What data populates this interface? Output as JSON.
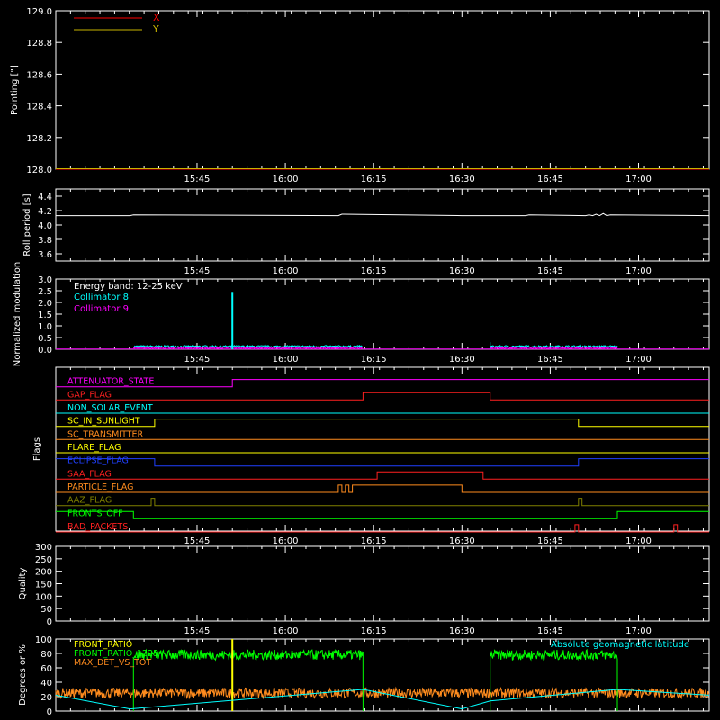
{
  "colors": {
    "background": "#000000",
    "axis": "#ffffff",
    "x_series": "#ff0000",
    "y_series": "#c8b400",
    "cyan": "#00ffff",
    "magenta": "#ff00ff",
    "green": "#00ff00",
    "orange": "#ff8c1e",
    "yellow": "#ffff00"
  },
  "time_axis": {
    "range_min": [
      15.35,
      17.2
    ],
    "tick_labels": [
      "15:45",
      "16:00",
      "16:15",
      "16:30",
      "16:45",
      "17:00"
    ],
    "tick_values_min": [
      15.75,
      16.0,
      16.25,
      16.5,
      16.75,
      17.0
    ]
  },
  "chart_data": [
    {
      "type": "line",
      "panel": "pointing",
      "ylabel": "Pointing [\"]",
      "ylim": [
        128.0,
        129.0
      ],
      "yticks": [
        "128.0",
        "128.2",
        "128.4",
        "128.6",
        "128.8",
        "129.0"
      ],
      "series": [
        {
          "name": "X",
          "x": [
            15.35,
            17.2
          ],
          "y": [
            128.0,
            128.0
          ]
        },
        {
          "name": "Y",
          "x": [
            15.35,
            17.2
          ],
          "y": [
            128.0,
            128.0
          ]
        }
      ],
      "legend_placement": "top-left"
    },
    {
      "type": "line",
      "panel": "roll",
      "ylabel": "Roll period [s]",
      "ylim": [
        3.5,
        4.5
      ],
      "yticks": [
        "3.6",
        "3.8",
        "4.0",
        "4.2",
        "4.4"
      ],
      "series": [
        {
          "x": [
            15.35,
            15.56,
            15.57,
            16.15,
            16.16,
            16.5,
            16.68,
            16.69,
            16.85,
            16.86,
            16.87,
            16.88,
            16.89,
            16.9,
            16.91,
            16.92,
            17.2
          ],
          "y": [
            4.13,
            4.13,
            4.14,
            4.13,
            4.15,
            4.13,
            4.13,
            4.14,
            4.13,
            4.14,
            4.13,
            4.15,
            4.13,
            4.16,
            4.13,
            4.14,
            4.13
          ]
        }
      ]
    },
    {
      "type": "line",
      "panel": "modulation",
      "ylabel": "Normalized modulation",
      "ylim": [
        0,
        3.0
      ],
      "yticks": [
        "0.0",
        "0.5",
        "1.0",
        "1.5",
        "2.0",
        "2.5",
        "3.0"
      ],
      "annotation": "Energy band: 12-25 keV",
      "active_intervals": [
        [
          15.57,
          16.22
        ],
        [
          16.58,
          16.94
        ]
      ],
      "series": [
        {
          "name": "Collimator 8",
          "base": 0.08,
          "spike_x": 15.85,
          "spike_y": 2.45
        },
        {
          "name": "Collimator 9",
          "base": 0.03
        }
      ]
    },
    {
      "type": "line",
      "panel": "flags",
      "ylabel": "Flags",
      "flags": [
        {
          "name": "ATTENUATOR_STATE",
          "color": "#ff00ff",
          "steps": [
            [
              15.35,
              0
            ],
            [
              15.85,
              1
            ],
            [
              17.2,
              1
            ]
          ]
        },
        {
          "name": "GAP_FLAG",
          "color": "#ff2020",
          "steps": [
            [
              15.35,
              0
            ],
            [
              16.22,
              1
            ],
            [
              16.58,
              0
            ],
            [
              17.2,
              0
            ]
          ]
        },
        {
          "name": "NON_SOLAR_EVENT",
          "color": "#00ffff",
          "steps": [
            [
              15.35,
              0
            ],
            [
              17.2,
              0
            ]
          ]
        },
        {
          "name": "SC_IN_SUNLIGHT",
          "color": "#ffff00",
          "steps": [
            [
              15.35,
              0
            ],
            [
              15.63,
              1
            ],
            [
              16.83,
              0
            ],
            [
              17.2,
              0
            ]
          ]
        },
        {
          "name": "SC_TRANSMITTER",
          "color": "#ff8c1e",
          "steps": [
            [
              15.35,
              0
            ],
            [
              17.2,
              0
            ]
          ]
        },
        {
          "name": "FLARE_FLAG",
          "color": "#ffff00",
          "steps": [
            [
              15.35,
              0
            ],
            [
              17.2,
              0
            ]
          ]
        },
        {
          "name": "ECLIPSE_FLAG",
          "color": "#2040ff",
          "steps": [
            [
              15.35,
              1
            ],
            [
              15.63,
              0
            ],
            [
              16.83,
              1
            ],
            [
              17.2,
              1
            ]
          ]
        },
        {
          "name": "SAA_FLAG",
          "color": "#ff2020",
          "steps": [
            [
              15.35,
              0
            ],
            [
              16.26,
              1
            ],
            [
              16.56,
              0
            ],
            [
              17.2,
              0
            ]
          ]
        },
        {
          "name": "PARTICLE_FLAG",
          "color": "#ff8c1e",
          "steps": [
            [
              15.35,
              0
            ],
            [
              16.15,
              1
            ],
            [
              16.16,
              0
            ],
            [
              16.17,
              1
            ],
            [
              16.18,
              0
            ],
            [
              16.19,
              1
            ],
            [
              16.5,
              0
            ],
            [
              17.2,
              0
            ]
          ]
        },
        {
          "name": "AAZ_FLAG",
          "color": "#808000",
          "steps": [
            [
              15.35,
              0
            ],
            [
              15.62,
              1
            ],
            [
              15.63,
              0
            ],
            [
              16.83,
              1
            ],
            [
              16.84,
              0
            ],
            [
              17.2,
              0
            ]
          ]
        },
        {
          "name": "FRONTS_OFF",
          "color": "#00ff00",
          "steps": [
            [
              15.35,
              1
            ],
            [
              15.57,
              0
            ],
            [
              16.94,
              1
            ],
            [
              17.2,
              1
            ]
          ]
        },
        {
          "name": "BAD_PACKETS",
          "color": "#ff2020",
          "steps": [
            [
              15.35,
              0
            ],
            [
              16.82,
              1
            ],
            [
              16.83,
              0
            ],
            [
              17.1,
              1
            ],
            [
              17.11,
              0
            ],
            [
              17.2,
              0
            ]
          ]
        }
      ]
    },
    {
      "type": "line",
      "panel": "quality",
      "ylabel": "Quality",
      "ylim": [
        0,
        300
      ],
      "yticks": [
        "0",
        "50",
        "100",
        "150",
        "200",
        "250",
        "300"
      ],
      "series": [
        {
          "x": [
            15.35,
            17.2
          ],
          "y": [
            0,
            0
          ]
        }
      ]
    },
    {
      "type": "line",
      "panel": "ratios",
      "ylabel": "Degrees or %",
      "ylim": [
        0,
        100
      ],
      "yticks": [
        "0",
        "20",
        "40",
        "60",
        "80",
        "100"
      ],
      "annotation": "Absolute geomagnetic latitude",
      "active_intervals": [
        [
          15.57,
          16.22
        ],
        [
          16.58,
          16.94
        ]
      ],
      "series": [
        {
          "name": "FRONT_RATIO",
          "color": "#ffff00",
          "spike_x": 15.85,
          "spike_y": 100
        },
        {
          "name": "FRONT_RATIO_1225",
          "color": "#00ff00",
          "base": 78
        },
        {
          "name": "MAX_DET_VS_TOT",
          "color": "#ff8c1e",
          "base": 25
        },
        {
          "name": "Absolute geomagnetic latitude",
          "color": "#00ffff",
          "x": [
            15.35,
            15.56,
            16.22,
            16.5,
            16.58,
            16.94,
            17.2
          ],
          "y": [
            22,
            3,
            30,
            3,
            14,
            30,
            22
          ]
        }
      ]
    }
  ]
}
